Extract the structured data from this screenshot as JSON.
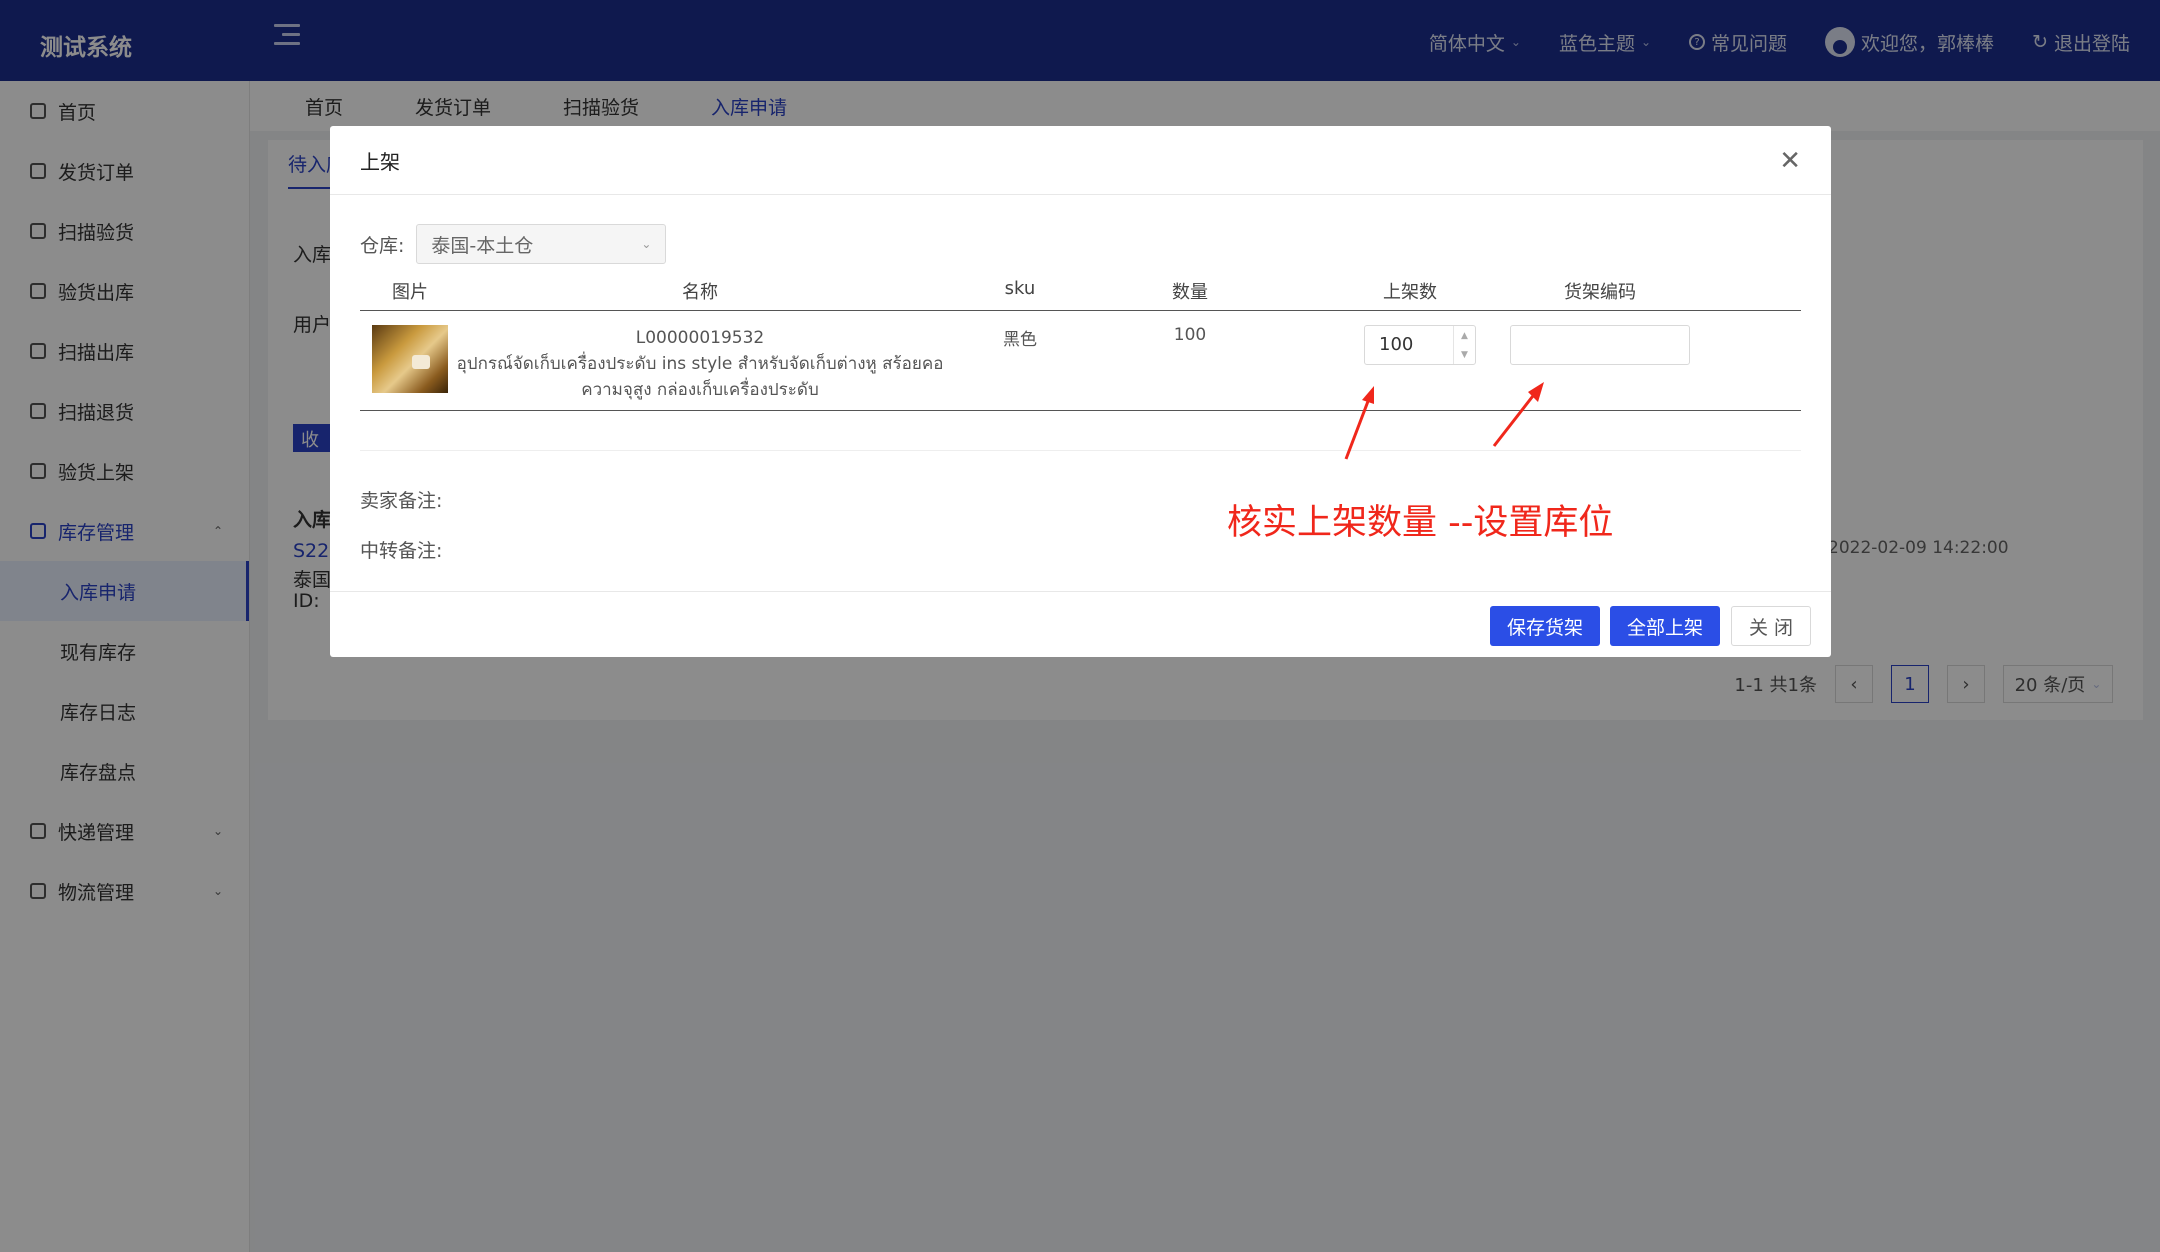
{
  "header": {
    "logo": "测试系统",
    "language": "简体中文",
    "theme": "蓝色主题",
    "faq": "常见问题",
    "welcome": "欢迎您，郭棒棒",
    "logout": "退出登陆"
  },
  "sidebar": {
    "items": [
      {
        "label": "首页"
      },
      {
        "label": "发货订单"
      },
      {
        "label": "扫描验货"
      },
      {
        "label": "验货出库"
      },
      {
        "label": "扫描出库"
      },
      {
        "label": "扫描退货"
      },
      {
        "label": "验货上架"
      },
      {
        "label": "库存管理"
      },
      {
        "label": "入库申请"
      },
      {
        "label": "现有库存"
      },
      {
        "label": "库存日志"
      },
      {
        "label": "库存盘点"
      },
      {
        "label": "快递管理"
      },
      {
        "label": "物流管理"
      }
    ]
  },
  "tabs": [
    "首页",
    "发货订单",
    "扫描验货",
    "入库申请"
  ],
  "background": {
    "card_tab": "待入库",
    "line1": "入库",
    "line2": "用户",
    "badge": "收",
    "row_title": "入库",
    "row_link": "S22",
    "row_sub": "泰国",
    "row_id": "ID:",
    "date": "2022-02-09 14:22:00",
    "pager_total": "1-1 共1条",
    "pager_current": "1",
    "pager_size": "20 条/页"
  },
  "modal": {
    "title": "上架",
    "warehouse_label": "仓库:",
    "warehouse_value": "泰国-本土仓",
    "columns": [
      "图片",
      "名称",
      "sku",
      "数量",
      "上架数",
      "货架编码"
    ],
    "row": {
      "code": "L00000019532",
      "name_line1": "อุปกรณ์จัดเก็บเครื่องประดับ ins style สำหรับจัดเก็บต่างหู สร้อยคอ",
      "name_line2": "ความจุสูง กล่องเก็บเครื่องประดับ",
      "sku": "黑色",
      "quantity": "100",
      "shelf_qty": "100",
      "shelf_code": ""
    },
    "seller_remark_label": "卖家备注:",
    "transit_remark_label": "中转备注:",
    "annotation": "核实上架数量 --设置库位",
    "buttons": {
      "save": "保存货架",
      "all": "全部上架",
      "close": "关 闭"
    }
  },
  "colors": {
    "header_bg": "#1d2f8f",
    "primary": "#2b4ee6",
    "annotation": "#f0271b"
  }
}
